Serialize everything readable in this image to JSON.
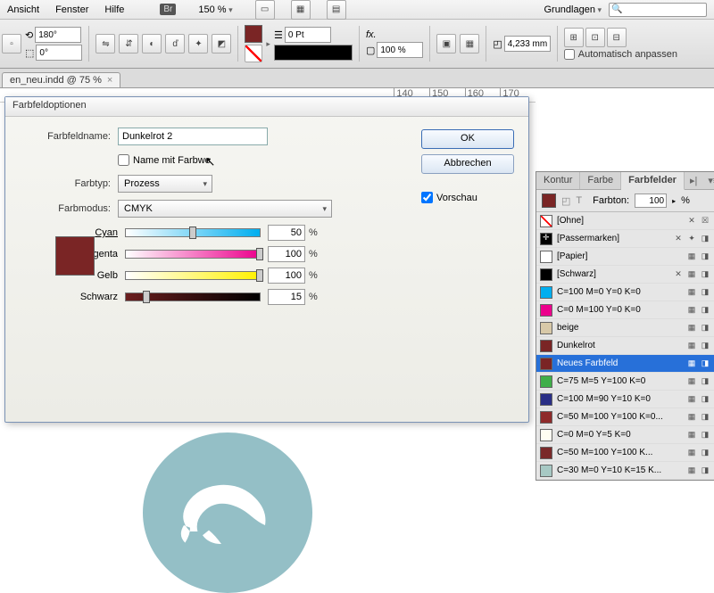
{
  "menu": {
    "ansicht": "Ansicht",
    "fenster": "Fenster",
    "hilfe": "Hilfe",
    "br": "Br",
    "zoom": "150 %",
    "grund": "Grundlagen"
  },
  "toolbar": {
    "rot1": "180°",
    "rot2": "0°",
    "pt": "0 Pt",
    "pct": "100 %",
    "mm": "4,233 mm",
    "autofit": "Automatisch anpassen"
  },
  "tab": {
    "name": "en_neu.indd @ 75 %"
  },
  "ruler": [
    "140",
    "150",
    "160",
    "170"
  ],
  "dialog": {
    "title": "Farbfeldoptionen",
    "name_label": "Farbfeldname:",
    "name_value": "Dunkelrot 2",
    "namemit": "Name mit Farbwe",
    "farbtyp_label": "Farbtyp:",
    "farbtyp_value": "Prozess",
    "farbmodus_label": "Farbmodus:",
    "farbmodus_value": "CMYK",
    "cyan": "Cyan",
    "magenta": "Magenta",
    "gelb": "Gelb",
    "schwarz": "Schwarz",
    "v_cyan": "50",
    "v_magenta": "100",
    "v_gelb": "100",
    "v_schwarz": "15",
    "ok": "OK",
    "cancel": "Abbrechen",
    "vorschau": "Vorschau"
  },
  "panel": {
    "tabs": {
      "kontur": "Kontur",
      "farbe": "Farbe",
      "farbfelder": "Farbfelder"
    },
    "farbton_label": "Farbton:",
    "farbton_val": "100",
    "pct": "%",
    "swatches": [
      {
        "name": "[Ohne]",
        "color": "none",
        "lock": true,
        "none": true
      },
      {
        "name": "[Passermarken]",
        "color": "reg",
        "lock": true,
        "reg": true
      },
      {
        "name": "[Papier]",
        "color": "#ffffff"
      },
      {
        "name": "[Schwarz]",
        "color": "#000000",
        "lock": true
      },
      {
        "name": "C=100 M=0 Y=0 K=0",
        "color": "#00aeef"
      },
      {
        "name": "C=0 M=100 Y=0 K=0",
        "color": "#ec008c"
      },
      {
        "name": "beige",
        "color": "#d8c9a8"
      },
      {
        "name": "Dunkelrot",
        "color": "#7a2525"
      },
      {
        "name": "Neues Farbfeld",
        "color": "#7a2525",
        "selected": true
      },
      {
        "name": "C=75 M=5 Y=100 K=0",
        "color": "#3fae49"
      },
      {
        "name": "C=100 M=90 Y=10 K=0",
        "color": "#2a2f86"
      },
      {
        "name": "C=50 M=100 Y=100 K=0...",
        "color": "#8e2a2a"
      },
      {
        "name": "C=0 M=0 Y=5 K=0",
        "color": "#fffef2"
      },
      {
        "name": "C=50 M=100 Y=100 K...",
        "color": "#7a2929"
      },
      {
        "name": "C=30 M=0 Y=10 K=15 K...",
        "color": "#a7c9c4"
      }
    ]
  }
}
